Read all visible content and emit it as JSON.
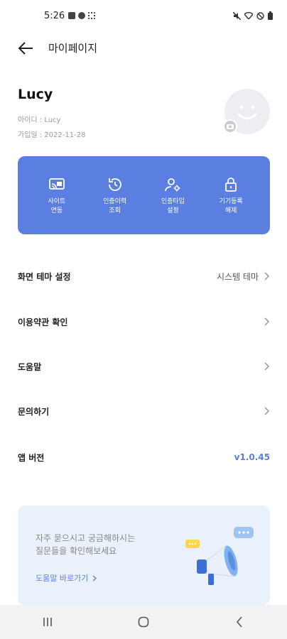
{
  "status_bar": {
    "time": "5:26"
  },
  "header": {
    "title": "마이페이지"
  },
  "profile": {
    "name": "Lucy",
    "id_label": "아이디 : ",
    "id_value": "Lucy",
    "joined_label": "가입일 : ",
    "joined_value": "2022-11-28"
  },
  "actions": [
    {
      "label": "사이트\n연동",
      "icon": "cast-screen-icon"
    },
    {
      "label": "인증이력\n조회",
      "icon": "history-icon"
    },
    {
      "label": "인증타입\n설정",
      "icon": "user-settings-icon"
    },
    {
      "label": "기기등록\n해제",
      "icon": "lock-icon"
    }
  ],
  "menu": {
    "theme_label": "화면 테마 설정",
    "theme_value": "시스템 테마",
    "terms_label": "이용약관 확인",
    "help_label": "도움말",
    "inquiry_label": "문의하기",
    "version_label": "앱 버전",
    "version_value": "v1.0.45"
  },
  "banner": {
    "text": "자주 묻으시고 궁금해하시는\n질문들을 확인해보세요",
    "link": "도움말 바로가기"
  },
  "colors": {
    "accent": "#5b7fe0",
    "banner_bg": "#eaf1fb"
  }
}
